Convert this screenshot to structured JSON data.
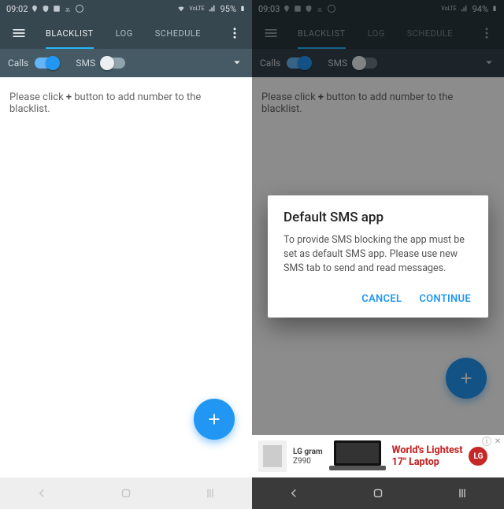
{
  "left": {
    "status": {
      "time": "09:02",
      "battery": "95%"
    },
    "tabs": {
      "blacklist": "BLACKLIST",
      "log": "LOG",
      "schedule": "SCHEDULE"
    },
    "toggles": {
      "calls": "Calls",
      "sms": "SMS"
    },
    "hint_pre": "Please click ",
    "hint_plus": "+",
    "hint_post": " button to add number to the blacklist."
  },
  "right": {
    "status": {
      "time": "09:03",
      "battery": "94%"
    },
    "tabs": {
      "blacklist": "BLACKLIST",
      "log": "LOG",
      "schedule": "SCHEDULE"
    },
    "toggles": {
      "calls": "Calls",
      "sms": "SMS"
    },
    "hint_pre": "Please click ",
    "hint_plus": "+",
    "hint_post": " button to add number to the blacklist.",
    "dialog": {
      "title": "Default SMS app",
      "body": "To provide SMS blocking the app must be set as default SMS app. Please use new SMS tab to send and read messages.",
      "cancel": "CANCEL",
      "continue": "CONTINUE"
    },
    "ad": {
      "brand_line1": "LG gram",
      "brand_line2": "Z990",
      "headline_line1": "World's Lightest",
      "headline_line2": "17\" Laptop",
      "logo": "LG"
    }
  }
}
